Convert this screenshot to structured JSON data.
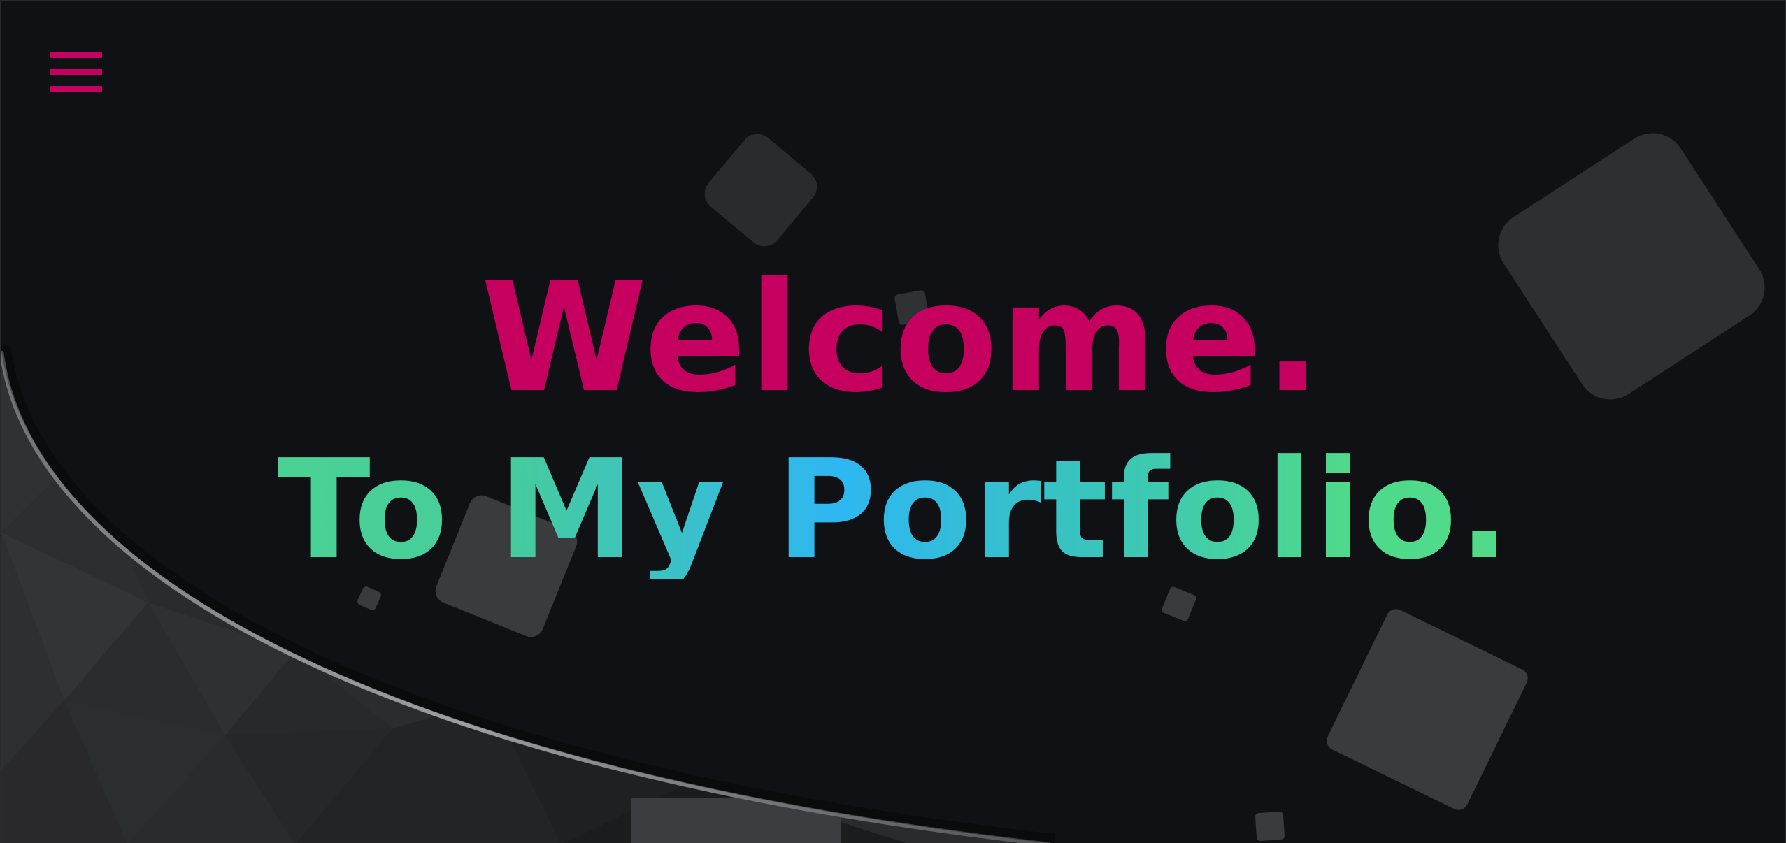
{
  "header": {
    "menu_icon": "hamburger-menu-icon"
  },
  "hero": {
    "line1": "Welcome.",
    "line2": "To My Portfolio."
  },
  "colors": {
    "background": "#101114",
    "accent": "#c5005e",
    "gradient_green": "#4ed98c",
    "gradient_blue": "#2eb7f2",
    "shape": "#38393c"
  }
}
